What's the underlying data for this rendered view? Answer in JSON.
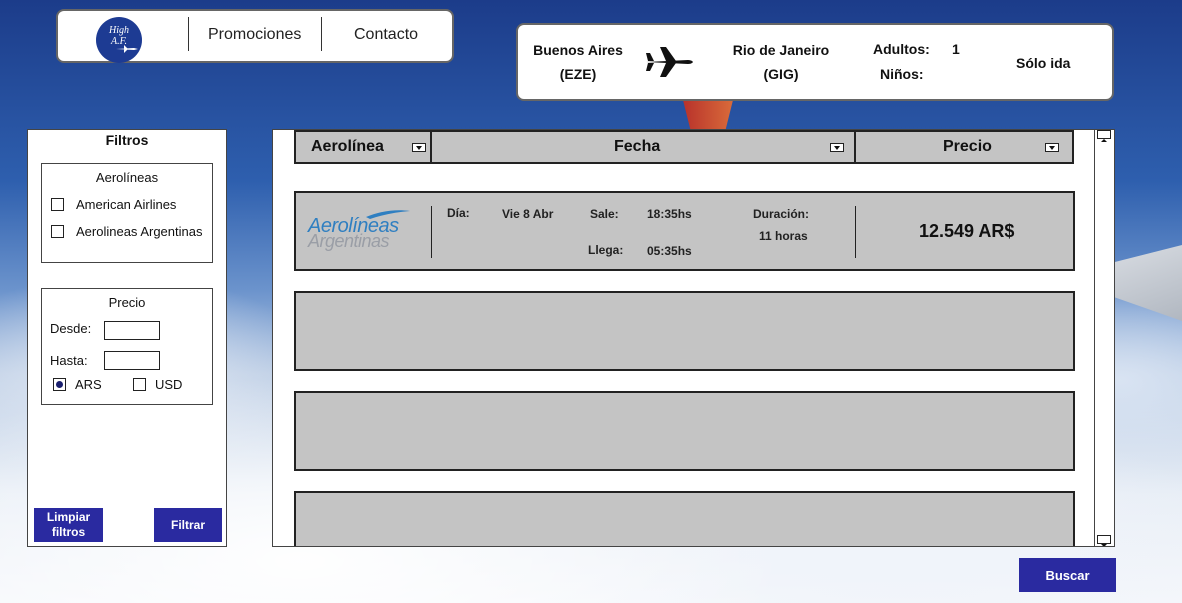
{
  "nav": {
    "logo_line1": "High",
    "logo_line2": "A.F.",
    "links": [
      "Promociones",
      "Contacto"
    ]
  },
  "trip": {
    "origin_city": "Buenos Aires",
    "origin_code": "(EZE)",
    "destination_city": "Rio de Janeiro",
    "destination_code": "(GIG)",
    "adults_label": "Adultos:",
    "adults_value": "1",
    "children_label": "Niños:",
    "children_value": "",
    "trip_type": "Sólo ida"
  },
  "filters": {
    "title": "Filtros",
    "airlines_title": "Aerolíneas",
    "airlines": [
      {
        "label": "American Airlines",
        "checked": false
      },
      {
        "label": "Aerolineas Argentinas",
        "checked": false
      }
    ],
    "price_title": "Precio",
    "from_label": "Desde:",
    "from_value": "",
    "to_label": "Hasta:",
    "to_value": "",
    "currencies": [
      {
        "label": "ARS",
        "selected": true
      },
      {
        "label": "USD",
        "selected": false
      }
    ],
    "clear_button": "Limpiar filtros",
    "apply_button": "Filtrar"
  },
  "results": {
    "columns": [
      "Aerolínea",
      "Fecha",
      "Precio"
    ],
    "flights": [
      {
        "airline_logo_line1": "Aerolíneas",
        "airline_logo_line2": "Argentinas",
        "day_label": "Día:",
        "day_value": "Vie 8 Abr",
        "departs_label": "Sale:",
        "departs_value": "18:35hs",
        "arrives_label": "Llega:",
        "arrives_value": "05:35hs",
        "duration_label": "Duración:",
        "duration_value": "11 horas",
        "price": "12.549 AR$"
      }
    ]
  },
  "search_button": "Buscar",
  "colors": {
    "button": "#2a2aa0",
    "logo": "#1d3b93",
    "card": "#c4c4c4",
    "airline_brand": "#2f7fc1"
  }
}
